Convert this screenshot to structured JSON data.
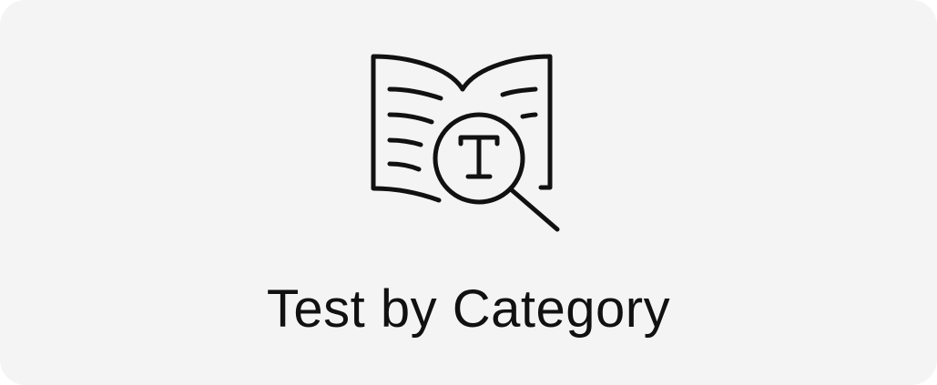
{
  "card": {
    "label": "Test by Category",
    "icon": "book-magnifier-icon",
    "background_color": "#f4f4f4",
    "text_color": "#111111",
    "icon_glyph": "T"
  }
}
